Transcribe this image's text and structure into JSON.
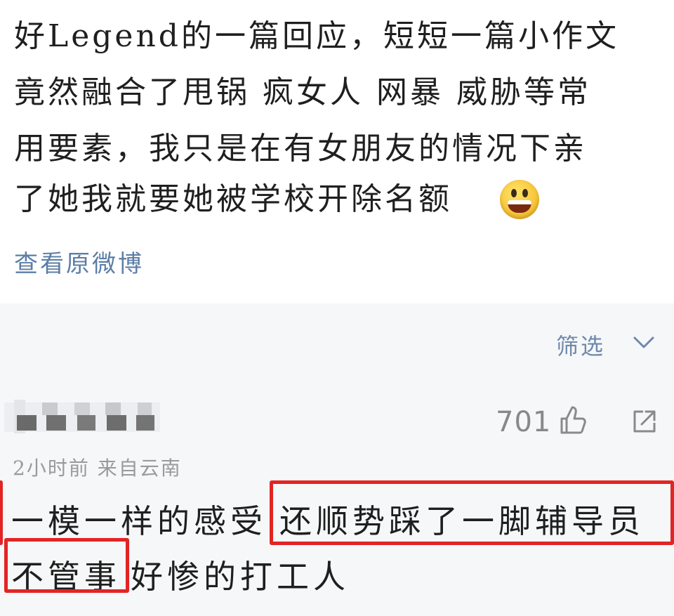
{
  "post": {
    "lines": [
      "好Legend的一篇回应，短短一篇小作文",
      "竟然融合了甩锅 疯女人 网暴 威胁等常",
      "用要素，我只是在有女朋友的情况下亲",
      "了她我就要她被学校开除名额"
    ],
    "emoji": "grinning-face",
    "view_original": "查看原微博"
  },
  "filter": {
    "label": "筛选"
  },
  "comment": {
    "likes": "701",
    "meta": "2小时前  来自云南",
    "line1_part1": "一模一样的感受",
    "line1_part2": "还顺势踩了一脚辅导员",
    "line2_part1": "不管事",
    "line2_part2": "好惨的打工人"
  },
  "colors": {
    "link": "#5b7ea6",
    "highlight_box": "#e32424",
    "muted": "#9a9a9a"
  }
}
